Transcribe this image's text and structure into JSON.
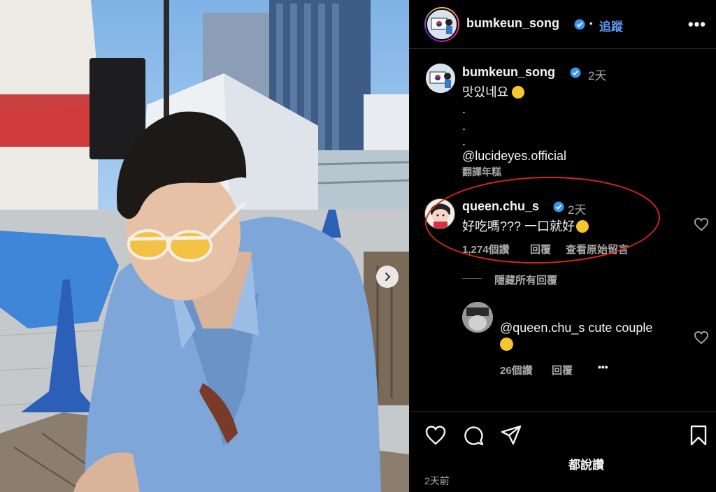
{
  "post": {
    "username": "bumkeun_song",
    "follow_label": "追蹤",
    "separator": "•",
    "more_label": "•••"
  },
  "caption": {
    "username": "bumkeun_song",
    "time": "2天",
    "line1": "맛있네요",
    "dot1": ".",
    "dot2": ".",
    "dot3": ".",
    "mention": "@lucideyes.official",
    "translate": "翻譯年糕"
  },
  "comment": {
    "username": "queen.chu_s",
    "time": "2天",
    "text": "好吃嗎??? 一口就好",
    "likes": "1,274個讚",
    "reply": "回覆",
    "view_original": "查看原始留言"
  },
  "hide_replies": "隱藏所有回覆",
  "reply": {
    "text": "@queen.chu_s cute couple",
    "likes": "26個讚",
    "reply": "回覆",
    "more": "•••"
  },
  "footer": {
    "likes_text": "都說讚",
    "date": "2天前"
  },
  "colors": {
    "accent_blue": "#5b9bf5",
    "verified_blue": "#3897f0",
    "annotation_red": "#d8261c"
  },
  "icons": [
    "heart-icon",
    "comment-icon",
    "share-icon",
    "bookmark-icon",
    "verified-icon",
    "chevron-right-icon"
  ]
}
